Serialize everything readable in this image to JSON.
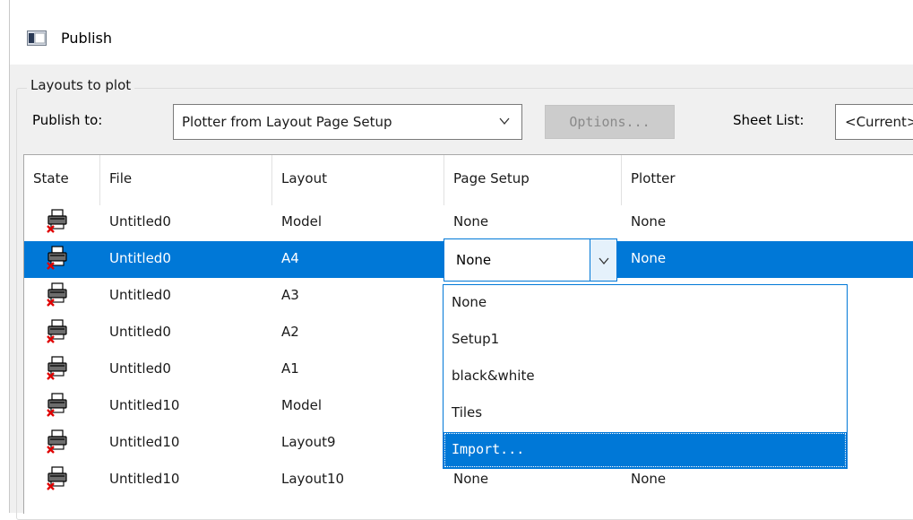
{
  "window": {
    "title": "Publish"
  },
  "layouts_group": {
    "legend": "Layouts to plot",
    "publish_to_label": "Publish to:",
    "publish_to_value": "Plotter from Layout Page Setup",
    "options_button": "Options...",
    "sheet_list_label": "Sheet List:",
    "sheet_list_value": "<Current>"
  },
  "table": {
    "columns": [
      "State",
      "File",
      "Layout",
      "Page Setup",
      "Plotter"
    ],
    "rows": [
      {
        "file": "Untitled0",
        "layout": "Model",
        "page_setup": "None",
        "plotter": "None",
        "state_icon": "printer-error-icon"
      },
      {
        "file": "Untitled0",
        "layout": "A4",
        "page_setup": "None",
        "plotter": "None",
        "state_icon": "printer-error-icon",
        "selected": true
      },
      {
        "file": "Untitled0",
        "layout": "A3",
        "page_setup": "",
        "plotter": "",
        "state_icon": "printer-error-icon"
      },
      {
        "file": "Untitled0",
        "layout": "A2",
        "page_setup": "",
        "plotter": "",
        "state_icon": "printer-error-icon"
      },
      {
        "file": "Untitled0",
        "layout": "A1",
        "page_setup": "",
        "plotter": "",
        "state_icon": "printer-error-icon"
      },
      {
        "file": "Untitled10",
        "layout": "Model",
        "page_setup": "",
        "plotter": "",
        "state_icon": "printer-error-icon"
      },
      {
        "file": "Untitled10",
        "layout": "Layout9",
        "page_setup": "",
        "plotter": "",
        "state_icon": "printer-error-icon"
      },
      {
        "file": "Untitled10",
        "layout": "Layout10",
        "page_setup": "None",
        "plotter": "None",
        "state_icon": "printer-error-icon"
      }
    ]
  },
  "page_setup_combo": {
    "value": "None",
    "options": [
      "None",
      "Setup1",
      "black&white",
      "Tiles",
      "Import..."
    ],
    "highlighted": "Import..."
  },
  "colors": {
    "selection": "#0078d7",
    "dialog_bg": "#f0f0f0"
  }
}
